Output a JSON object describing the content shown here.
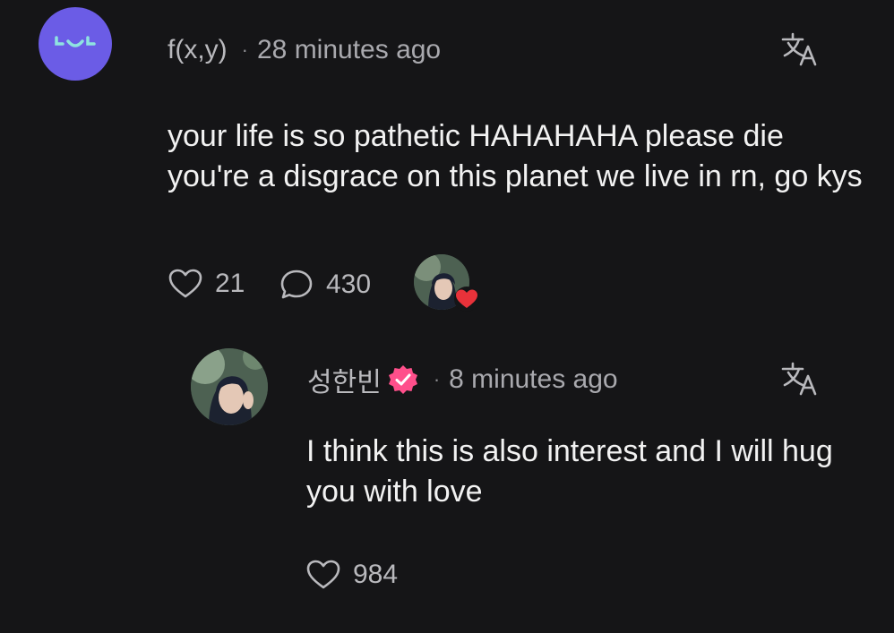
{
  "comments": [
    {
      "author": "f(x,y)",
      "separator": "·",
      "time": "28 minutes ago",
      "text": "your life is so pathetic HAHAHAHA please die you're a disgrace on this planet we live in rn, go kys",
      "likes": "21",
      "replies": "430",
      "avatar_icon": "smiley-face-icon",
      "avatar_color": "#6b5ce6",
      "liked_by_creator": true,
      "heart_color": "#e8323a"
    },
    {
      "author": "성한빈",
      "verified": true,
      "badge_color": "#ff4f8b",
      "separator": "·",
      "time": "8 minutes ago",
      "text": "I think this is also interest and I will hug you with love",
      "likes": "984"
    }
  ],
  "icons": {
    "translate": "translate-icon",
    "like": "heart-outline-icon",
    "reply": "speech-bubble-icon"
  },
  "colors": {
    "background": "#151517",
    "text_primary": "#f2f2f2",
    "text_secondary": "#b9b9bd"
  }
}
